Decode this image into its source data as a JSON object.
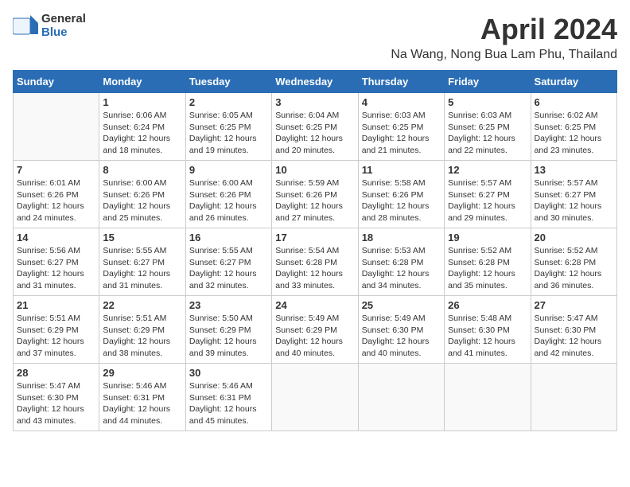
{
  "header": {
    "logo_line1": "General",
    "logo_line2": "Blue",
    "month": "April 2024",
    "location": "Na Wang, Nong Bua Lam Phu, Thailand"
  },
  "weekdays": [
    "Sunday",
    "Monday",
    "Tuesday",
    "Wednesday",
    "Thursday",
    "Friday",
    "Saturday"
  ],
  "weeks": [
    [
      {
        "day": "",
        "info": ""
      },
      {
        "day": "1",
        "info": "Sunrise: 6:06 AM\nSunset: 6:24 PM\nDaylight: 12 hours\nand 18 minutes."
      },
      {
        "day": "2",
        "info": "Sunrise: 6:05 AM\nSunset: 6:25 PM\nDaylight: 12 hours\nand 19 minutes."
      },
      {
        "day": "3",
        "info": "Sunrise: 6:04 AM\nSunset: 6:25 PM\nDaylight: 12 hours\nand 20 minutes."
      },
      {
        "day": "4",
        "info": "Sunrise: 6:03 AM\nSunset: 6:25 PM\nDaylight: 12 hours\nand 21 minutes."
      },
      {
        "day": "5",
        "info": "Sunrise: 6:03 AM\nSunset: 6:25 PM\nDaylight: 12 hours\nand 22 minutes."
      },
      {
        "day": "6",
        "info": "Sunrise: 6:02 AM\nSunset: 6:25 PM\nDaylight: 12 hours\nand 23 minutes."
      }
    ],
    [
      {
        "day": "7",
        "info": "Sunrise: 6:01 AM\nSunset: 6:26 PM\nDaylight: 12 hours\nand 24 minutes."
      },
      {
        "day": "8",
        "info": "Sunrise: 6:00 AM\nSunset: 6:26 PM\nDaylight: 12 hours\nand 25 minutes."
      },
      {
        "day": "9",
        "info": "Sunrise: 6:00 AM\nSunset: 6:26 PM\nDaylight: 12 hours\nand 26 minutes."
      },
      {
        "day": "10",
        "info": "Sunrise: 5:59 AM\nSunset: 6:26 PM\nDaylight: 12 hours\nand 27 minutes."
      },
      {
        "day": "11",
        "info": "Sunrise: 5:58 AM\nSunset: 6:26 PM\nDaylight: 12 hours\nand 28 minutes."
      },
      {
        "day": "12",
        "info": "Sunrise: 5:57 AM\nSunset: 6:27 PM\nDaylight: 12 hours\nand 29 minutes."
      },
      {
        "day": "13",
        "info": "Sunrise: 5:57 AM\nSunset: 6:27 PM\nDaylight: 12 hours\nand 30 minutes."
      }
    ],
    [
      {
        "day": "14",
        "info": "Sunrise: 5:56 AM\nSunset: 6:27 PM\nDaylight: 12 hours\nand 31 minutes."
      },
      {
        "day": "15",
        "info": "Sunrise: 5:55 AM\nSunset: 6:27 PM\nDaylight: 12 hours\nand 31 minutes."
      },
      {
        "day": "16",
        "info": "Sunrise: 5:55 AM\nSunset: 6:27 PM\nDaylight: 12 hours\nand 32 minutes."
      },
      {
        "day": "17",
        "info": "Sunrise: 5:54 AM\nSunset: 6:28 PM\nDaylight: 12 hours\nand 33 minutes."
      },
      {
        "day": "18",
        "info": "Sunrise: 5:53 AM\nSunset: 6:28 PM\nDaylight: 12 hours\nand 34 minutes."
      },
      {
        "day": "19",
        "info": "Sunrise: 5:52 AM\nSunset: 6:28 PM\nDaylight: 12 hours\nand 35 minutes."
      },
      {
        "day": "20",
        "info": "Sunrise: 5:52 AM\nSunset: 6:28 PM\nDaylight: 12 hours\nand 36 minutes."
      }
    ],
    [
      {
        "day": "21",
        "info": "Sunrise: 5:51 AM\nSunset: 6:29 PM\nDaylight: 12 hours\nand 37 minutes."
      },
      {
        "day": "22",
        "info": "Sunrise: 5:51 AM\nSunset: 6:29 PM\nDaylight: 12 hours\nand 38 minutes."
      },
      {
        "day": "23",
        "info": "Sunrise: 5:50 AM\nSunset: 6:29 PM\nDaylight: 12 hours\nand 39 minutes."
      },
      {
        "day": "24",
        "info": "Sunrise: 5:49 AM\nSunset: 6:29 PM\nDaylight: 12 hours\nand 40 minutes."
      },
      {
        "day": "25",
        "info": "Sunrise: 5:49 AM\nSunset: 6:30 PM\nDaylight: 12 hours\nand 40 minutes."
      },
      {
        "day": "26",
        "info": "Sunrise: 5:48 AM\nSunset: 6:30 PM\nDaylight: 12 hours\nand 41 minutes."
      },
      {
        "day": "27",
        "info": "Sunrise: 5:47 AM\nSunset: 6:30 PM\nDaylight: 12 hours\nand 42 minutes."
      }
    ],
    [
      {
        "day": "28",
        "info": "Sunrise: 5:47 AM\nSunset: 6:30 PM\nDaylight: 12 hours\nand 43 minutes."
      },
      {
        "day": "29",
        "info": "Sunrise: 5:46 AM\nSunset: 6:31 PM\nDaylight: 12 hours\nand 44 minutes."
      },
      {
        "day": "30",
        "info": "Sunrise: 5:46 AM\nSunset: 6:31 PM\nDaylight: 12 hours\nand 45 minutes."
      },
      {
        "day": "",
        "info": ""
      },
      {
        "day": "",
        "info": ""
      },
      {
        "day": "",
        "info": ""
      },
      {
        "day": "",
        "info": ""
      }
    ]
  ]
}
